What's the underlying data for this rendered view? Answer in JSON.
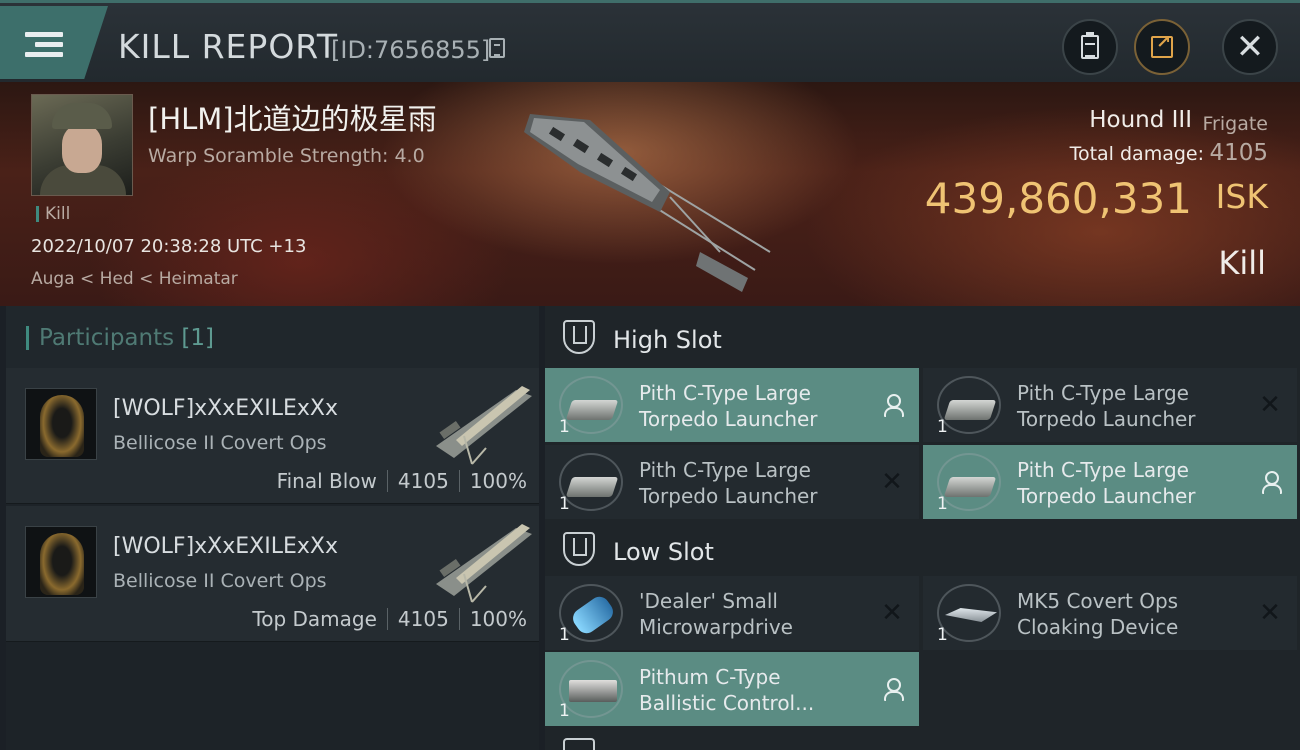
{
  "header": {
    "title": "KILL REPORT",
    "report_id": "[ID:7656855]"
  },
  "victim": {
    "name": "[HLM]北道边的极星雨",
    "warp_scramble": "Warp Soramble Strength: 4.0",
    "tag": "Kill",
    "datetime": "2022/10/07 20:38:28 UTC +13",
    "location": "Auga < Hed < Heimatar"
  },
  "ship": {
    "name": "Hound III",
    "class": "Frigate",
    "total_damage_label": "Total damage:",
    "total_damage": "4105",
    "isk_value": "439,860,331",
    "isk_unit": "ISK",
    "result": "Kill"
  },
  "participants": {
    "title": "Participants",
    "count": "[1]",
    "rows": [
      {
        "name": "[WOLF]xXxEXILExXx",
        "ship": "Bellicose II Covert Ops",
        "role": "Final Blow",
        "damage": "4105",
        "percent": "100%"
      },
      {
        "name": "[WOLF]xXxEXILExXx",
        "ship": "Bellicose II Covert Ops",
        "role": "Top Damage",
        "damage": "4105",
        "percent": "100%"
      }
    ]
  },
  "fitting": {
    "high_slot": {
      "title": "High Slot",
      "modules": [
        {
          "name": "Pith C-Type Large\nTorpedo Launcher",
          "qty": "1",
          "status": "dropped",
          "icon": "torpedo-launcher-icon"
        },
        {
          "name": "Pith C-Type Large\nTorpedo Launcher",
          "qty": "1",
          "status": "destroyed",
          "icon": "torpedo-launcher-icon"
        },
        {
          "name": "Pith C-Type Large\nTorpedo Launcher",
          "qty": "1",
          "status": "destroyed",
          "icon": "torpedo-launcher-icon"
        },
        {
          "name": "Pith C-Type Large\nTorpedo Launcher",
          "qty": "1",
          "status": "dropped",
          "icon": "torpedo-launcher-icon"
        }
      ]
    },
    "low_slot": {
      "title": "Low Slot",
      "modules": [
        {
          "name": "'Dealer' Small\nMicrowarpdrive",
          "qty": "1",
          "status": "destroyed",
          "icon": "microwarpdrive-icon"
        },
        {
          "name": "MK5 Covert Ops\nCloaking Device",
          "qty": "1",
          "status": "destroyed",
          "icon": "cloaking-device-icon"
        },
        {
          "name": "Pithum C-Type\nBallistic Control...",
          "qty": "1",
          "status": "dropped",
          "icon": "ballistic-control-icon"
        }
      ]
    }
  }
}
